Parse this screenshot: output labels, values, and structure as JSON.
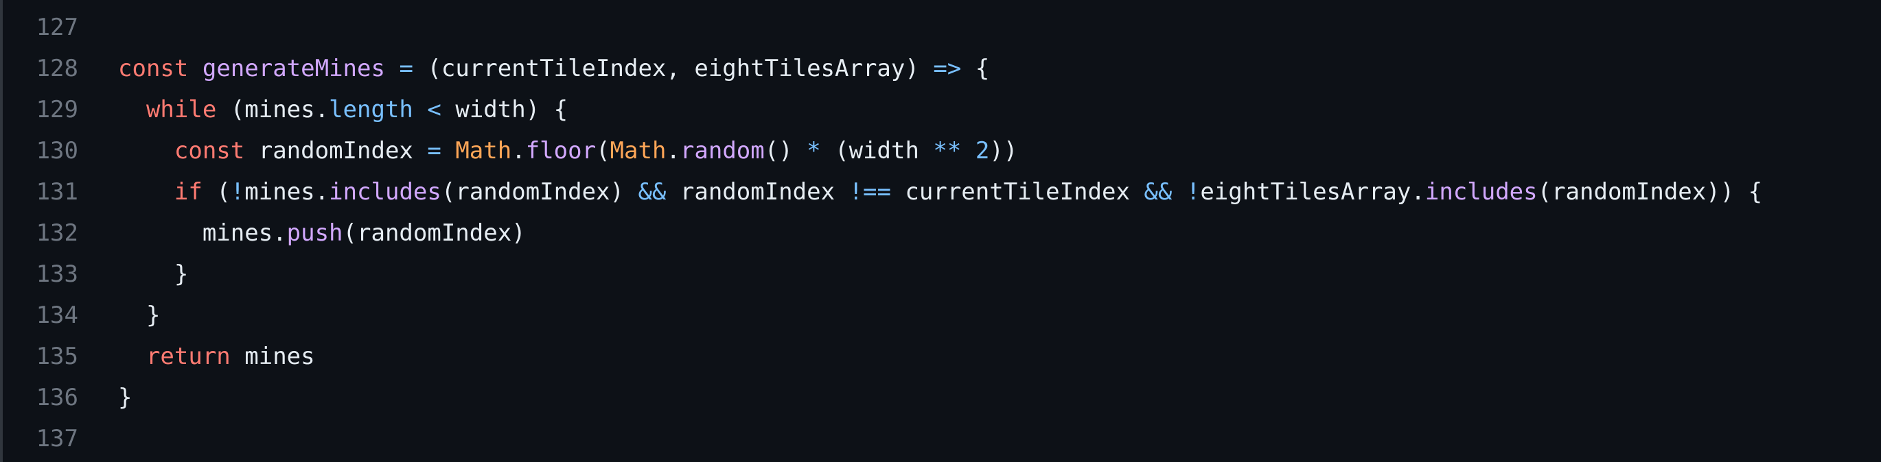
{
  "editor": {
    "lines": [
      {
        "number": "127",
        "tokens": []
      },
      {
        "number": "128",
        "tokens": [
          {
            "t": "kw",
            "v": "const"
          },
          {
            "t": "plain",
            "v": " "
          },
          {
            "t": "fn",
            "v": "generateMines"
          },
          {
            "t": "plain",
            "v": " "
          },
          {
            "t": "op",
            "v": "="
          },
          {
            "t": "plain",
            "v": " (currentTileIndex, eightTilesArray) "
          },
          {
            "t": "op",
            "v": "=>"
          },
          {
            "t": "plain",
            "v": " {"
          }
        ]
      },
      {
        "number": "129",
        "tokens": [
          {
            "t": "plain",
            "v": "  "
          },
          {
            "t": "kw",
            "v": "while"
          },
          {
            "t": "plain",
            "v": " (mines."
          },
          {
            "t": "prop",
            "v": "length"
          },
          {
            "t": "plain",
            "v": " "
          },
          {
            "t": "op",
            "v": "<"
          },
          {
            "t": "plain",
            "v": " width) {"
          }
        ]
      },
      {
        "number": "130",
        "tokens": [
          {
            "t": "plain",
            "v": "    "
          },
          {
            "t": "kw",
            "v": "const"
          },
          {
            "t": "plain",
            "v": " randomIndex "
          },
          {
            "t": "op",
            "v": "="
          },
          {
            "t": "plain",
            "v": " "
          },
          {
            "t": "cls",
            "v": "Math"
          },
          {
            "t": "plain",
            "v": "."
          },
          {
            "t": "fn",
            "v": "floor"
          },
          {
            "t": "plain",
            "v": "("
          },
          {
            "t": "cls",
            "v": "Math"
          },
          {
            "t": "plain",
            "v": "."
          },
          {
            "t": "fn",
            "v": "random"
          },
          {
            "t": "plain",
            "v": "() "
          },
          {
            "t": "op",
            "v": "*"
          },
          {
            "t": "plain",
            "v": " (width "
          },
          {
            "t": "op",
            "v": "**"
          },
          {
            "t": "plain",
            "v": " "
          },
          {
            "t": "num",
            "v": "2"
          },
          {
            "t": "plain",
            "v": "))"
          }
        ]
      },
      {
        "number": "131",
        "tokens": [
          {
            "t": "plain",
            "v": "    "
          },
          {
            "t": "kw",
            "v": "if"
          },
          {
            "t": "plain",
            "v": " ("
          },
          {
            "t": "op",
            "v": "!"
          },
          {
            "t": "plain",
            "v": "mines."
          },
          {
            "t": "fn",
            "v": "includes"
          },
          {
            "t": "plain",
            "v": "(randomIndex) "
          },
          {
            "t": "op",
            "v": "&&"
          },
          {
            "t": "plain",
            "v": " randomIndex "
          },
          {
            "t": "op",
            "v": "!=="
          },
          {
            "t": "plain",
            "v": " currentTileIndex "
          },
          {
            "t": "op",
            "v": "&&"
          },
          {
            "t": "plain",
            "v": " "
          },
          {
            "t": "op",
            "v": "!"
          },
          {
            "t": "plain",
            "v": "eightTilesArray."
          },
          {
            "t": "fn",
            "v": "includes"
          },
          {
            "t": "plain",
            "v": "(randomIndex)) {"
          }
        ]
      },
      {
        "number": "132",
        "tokens": [
          {
            "t": "plain",
            "v": "      mines."
          },
          {
            "t": "fn",
            "v": "push"
          },
          {
            "t": "plain",
            "v": "(randomIndex)"
          }
        ]
      },
      {
        "number": "133",
        "tokens": [
          {
            "t": "plain",
            "v": "    }"
          }
        ]
      },
      {
        "number": "134",
        "tokens": [
          {
            "t": "plain",
            "v": "  }"
          }
        ]
      },
      {
        "number": "135",
        "tokens": [
          {
            "t": "plain",
            "v": "  "
          },
          {
            "t": "kw",
            "v": "return"
          },
          {
            "t": "plain",
            "v": " mines"
          }
        ]
      },
      {
        "number": "136",
        "tokens": [
          {
            "t": "plain",
            "v": "}"
          }
        ]
      },
      {
        "number": "137",
        "tokens": []
      }
    ]
  },
  "colors": {
    "background": "#0d1117",
    "line_number": "#6e7681",
    "keyword": "#ff7b72",
    "function": "#d2a8ff",
    "operator": "#79c0ff",
    "class": "#ffa657",
    "text": "#e6edf3"
  }
}
